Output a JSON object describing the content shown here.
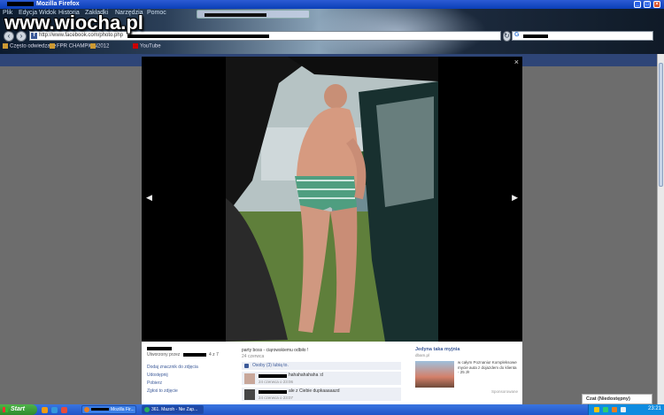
{
  "window": {
    "title": "Mozilla Firefox"
  },
  "watermark": "www.wiocha.pl",
  "browser": {
    "menu": [
      "Plik",
      "Edycja",
      "Widok",
      "Historia",
      "Zakładki",
      "Narzędzia",
      "Pomoc"
    ],
    "url": "http://www.facebook.com/photo.php",
    "search_engine_icon": "google-icon",
    "bookmarks": [
      "Często odwiedzane",
      "FPR CHAMPION",
      "2012",
      "YouTube"
    ]
  },
  "photo_viewer": {
    "close_label": "×",
    "prev_label": "◀",
    "next_label": "▶"
  },
  "info": {
    "uploaded_prefix": "Utworzony przez",
    "uploaded_suffix": "4 z 7",
    "links": [
      "Dodaj znacznik do zdjęcia",
      "Udostępnij",
      "Pobierz",
      "Zgłoś to zdjęcie"
    ],
    "caption": "party boss - ciąrowskiemu odbiło !",
    "date": "24 czerwca",
    "likes_text": "Osoby (3) lubią to.",
    "comments": [
      {
        "text": "hahahahahaha :d",
        "time": "24 czerwca o 23:06"
      },
      {
        "text": "ale z Ciebie dupkaaaaazd",
        "time": "24 czerwca o 23:07"
      }
    ],
    "ad": {
      "title": "Jedyna taka myjnia",
      "domain": "dbam.pl",
      "text": "w całym Poznaniu! Kompleksowe mycie auta z dojazdem do klienta - 25 zł!",
      "sponsored": "Sponsorowane"
    }
  },
  "chat": {
    "label": "Czat (Niedostępny)"
  },
  "taskbar": {
    "start_label": "Start",
    "tasks": [
      "Mozilla Fir...",
      "361. Mazoh - Nie Zap..."
    ],
    "clock": "23:21"
  }
}
